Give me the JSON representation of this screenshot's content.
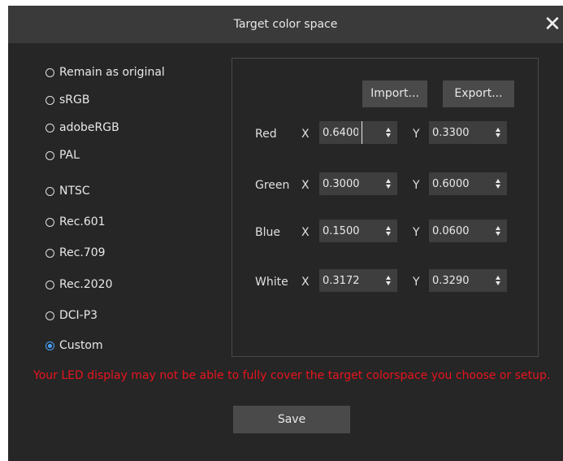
{
  "title": "Target color space",
  "close_glyph": "✕",
  "options": [
    {
      "label": "Remain as original",
      "selected": false
    },
    {
      "label": "sRGB",
      "selected": false
    },
    {
      "label": "adobeRGB",
      "selected": false
    },
    {
      "label": "PAL",
      "selected": false
    },
    {
      "label": "NTSC",
      "selected": false
    },
    {
      "label": "Rec.601",
      "selected": false
    },
    {
      "label": "Rec.709",
      "selected": false
    },
    {
      "label": "Rec.2020",
      "selected": false
    },
    {
      "label": "DCI-P3",
      "selected": false
    },
    {
      "label": "Custom",
      "selected": true
    }
  ],
  "buttons": {
    "import": "Import...",
    "export": "Export..."
  },
  "axis": {
    "x": "X",
    "y": "Y"
  },
  "rows": [
    {
      "label": "Red",
      "x": "0.6400",
      "y": "0.3300"
    },
    {
      "label": "Green",
      "x": "0.3000",
      "y": "0.6000"
    },
    {
      "label": "Blue",
      "x": "0.1500",
      "y": "0.0600"
    },
    {
      "label": "White",
      "x": "0.3172",
      "y": "0.3290"
    }
  ],
  "warning": "Your LED display may not be able to fully cover the target colorspace you choose or setup.",
  "save_label": "Save",
  "colors": {
    "accent": "#4aa3ff",
    "warning": "#e8141e",
    "background": "#262626"
  }
}
